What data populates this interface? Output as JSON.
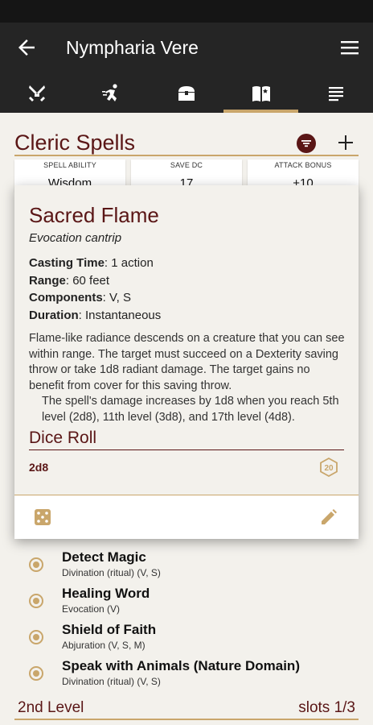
{
  "appbar": {
    "title": "Nympharia Vere",
    "tabs": [
      "combat-icon",
      "skills-icon",
      "inventory-icon",
      "spellbook-icon",
      "notes-icon"
    ],
    "active_tab": 3
  },
  "section": {
    "title": "Cleric Spells"
  },
  "stats": {
    "ability_label": "SPELL ABILITY",
    "ability_value": "Wisdom",
    "save_label": "SAVE DC",
    "save_value": "17",
    "attack_label": "ATTACK BONUS",
    "attack_value": "+10"
  },
  "spell_detail": {
    "name": "Sacred Flame",
    "school": "Evocation cantrip",
    "casting_time_label": "Casting Time",
    "casting_time": "1 action",
    "range_label": "Range",
    "range": "60 feet",
    "components_label": "Components",
    "components": "V, S",
    "duration_label": "Duration",
    "duration": "Instantaneous",
    "description": "Flame-like radiance descends on a creature that you can see within range. The target must succeed on a Dexterity saving throw or take 1d8 radiant damage. The target gains no benefit from cover for this saving throw.",
    "description_2": "The spell's damage increases by 1d8 when you reach 5th level (2d8), 11th level (3d8), and 17th level (4d8).",
    "dice_roll_label": "Dice Roll",
    "dice_value": "2d8",
    "d20_label": "20"
  },
  "spells": [
    {
      "name": "Detect Magic",
      "meta": "Divination (ritual) (V, S)"
    },
    {
      "name": "Healing Word",
      "meta": "Evocation (V)"
    },
    {
      "name": "Shield of Faith",
      "meta": "Abjuration (V, S, M)"
    },
    {
      "name": "Speak with Animals (Nature Domain)",
      "meta": "Divination (ritual) (V, S)"
    }
  ],
  "level_header": {
    "level": "2nd Level",
    "slots": "slots 1/3"
  },
  "colors": {
    "accent": "#c9a66b",
    "maroon": "#5a1616",
    "appbar": "#252525",
    "background": "#f3f1ec"
  }
}
